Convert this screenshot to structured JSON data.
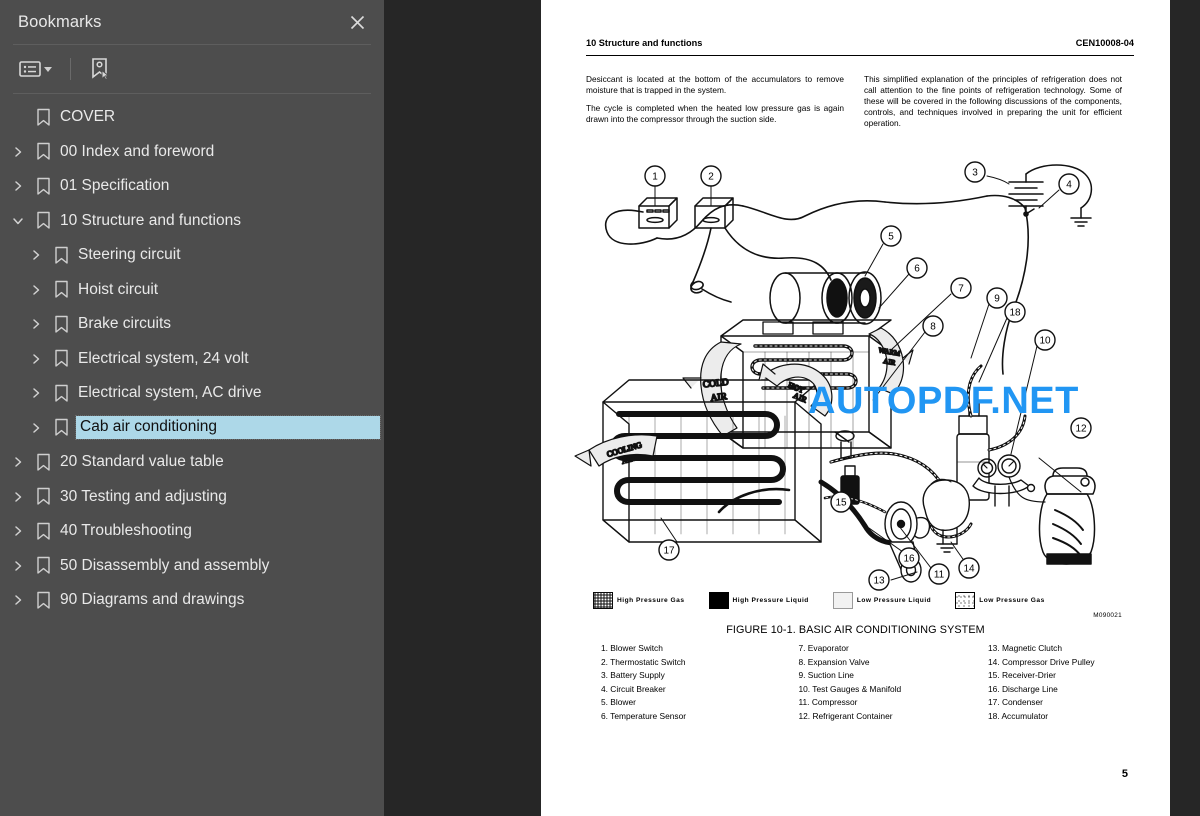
{
  "sidebar": {
    "title": "Bookmarks",
    "close_icon": "close-icon",
    "toolbar": {
      "options_icon": "list-options-icon",
      "caret_icon": "chevron-down-icon",
      "new_bookmark_icon": "new-bookmark-icon"
    },
    "items": [
      {
        "label": "COVER",
        "level": 1,
        "expandable": false,
        "expanded": false,
        "selected": false
      },
      {
        "label": "00 Index and foreword",
        "level": 1,
        "expandable": true,
        "expanded": false,
        "selected": false
      },
      {
        "label": "01 Specification",
        "level": 1,
        "expandable": true,
        "expanded": false,
        "selected": false
      },
      {
        "label": "10 Structure and functions",
        "level": 1,
        "expandable": true,
        "expanded": true,
        "selected": false
      },
      {
        "label": "Steering circuit",
        "level": 2,
        "expandable": true,
        "expanded": false,
        "selected": false
      },
      {
        "label": "Hoist circuit",
        "level": 2,
        "expandable": true,
        "expanded": false,
        "selected": false
      },
      {
        "label": "Brake circuits",
        "level": 2,
        "expandable": true,
        "expanded": false,
        "selected": false
      },
      {
        "label": "Electrical system, 24 volt",
        "level": 2,
        "expandable": true,
        "expanded": false,
        "selected": false
      },
      {
        "label": "Electrical system, AC drive",
        "level": 2,
        "expandable": true,
        "expanded": false,
        "selected": false
      },
      {
        "label": "Cab air conditioning",
        "level": 2,
        "expandable": true,
        "expanded": false,
        "selected": true
      },
      {
        "label": "20 Standard value table",
        "level": 1,
        "expandable": true,
        "expanded": false,
        "selected": false
      },
      {
        "label": "30 Testing and adjusting",
        "level": 1,
        "expandable": true,
        "expanded": false,
        "selected": false
      },
      {
        "label": "40 Troubleshooting",
        "level": 1,
        "expandable": true,
        "expanded": false,
        "selected": false
      },
      {
        "label": "50 Disassembly and assembly",
        "level": 1,
        "expandable": true,
        "expanded": false,
        "selected": false
      },
      {
        "label": "90 Diagrams and drawings",
        "level": 1,
        "expandable": true,
        "expanded": false,
        "selected": false
      }
    ],
    "colors": {
      "panel_bg": "#4d4d4d",
      "selection_bg": "#add8e8",
      "viewer_bg": "#262626"
    }
  },
  "viewer": {
    "collapse_handle_icon": "collapse-panel-icon",
    "watermark": "AUTOPDF.NET",
    "watermark_color": "#2196f3"
  },
  "document": {
    "header_left": "10 Structure and functions",
    "header_right": "CEN10008-04",
    "body_left": [
      "Desiccant is located at the bottom of the accumulators to remove moisture that is trapped in the system.",
      "The cycle is completed when the heated low pressure gas is again drawn into the compressor through the suction side."
    ],
    "body_right": [
      "This simplified explanation of the principles of refrigeration does not call attention to the fine points of refrigeration technology. Some of these will be covered in the following discussions of the components, controls, and techniques involved in preparing the unit for efficient operation."
    ],
    "figure": {
      "caption": "FIGURE 10-1. BASIC AIR CONDITIONING SYSTEM",
      "figure_id": "M090021",
      "air_labels": [
        "COLD AIR",
        "WARM AIR",
        "HOT AIR",
        "COOLING AIR"
      ],
      "callouts": [
        "1",
        "2",
        "3",
        "4",
        "5",
        "6",
        "7",
        "8",
        "9",
        "10",
        "11",
        "12",
        "13",
        "14",
        "15",
        "16",
        "17",
        "18"
      ],
      "legend": [
        {
          "label": "High Pressure Gas",
          "swatch": "hpg"
        },
        {
          "label": "High Pressure Liquid",
          "swatch": "hpl"
        },
        {
          "label": "Low Pressure Liquid",
          "swatch": "lpl"
        },
        {
          "label": "Low Pressure Gas",
          "swatch": "lpg"
        }
      ],
      "parts_col1": [
        "1. Blower Switch",
        "2. Thermostatic Switch",
        "3. Battery Supply",
        "4. Circuit Breaker",
        "5. Blower",
        "6. Temperature Sensor"
      ],
      "parts_col2": [
        "7. Evaporator",
        "8. Expansion Valve",
        "9. Suction Line",
        "10. Test Gauges & Manifold",
        "11. Compressor",
        "12. Refrigerant Container"
      ],
      "parts_col3": [
        "13. Magnetic Clutch",
        "14. Compressor Drive Pulley",
        "15. Receiver-Drier",
        "16. Discharge Line",
        "17. Condenser",
        "18. Accumulator"
      ]
    },
    "page_number": "5"
  }
}
